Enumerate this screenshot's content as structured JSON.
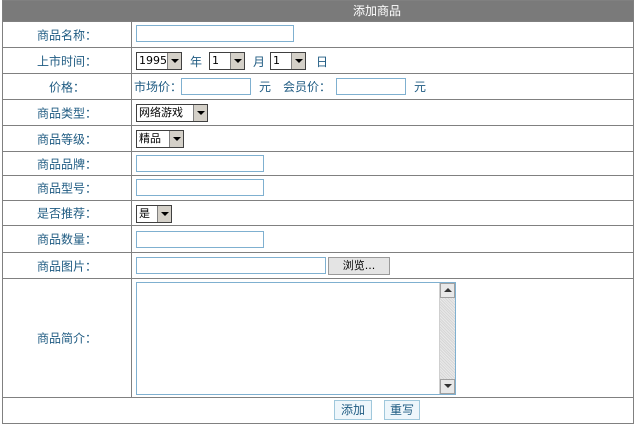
{
  "title": "添加商品",
  "fields": {
    "name": {
      "label": "商品名称：",
      "value": ""
    },
    "release": {
      "label": "上市时间：",
      "year": "1995",
      "year_unit": "年",
      "month": "1",
      "month_unit": "月",
      "day": "1",
      "day_unit": "日"
    },
    "price": {
      "label": "价格：",
      "market_label": "市场价：",
      "member_label": "会员价：",
      "unit": "元"
    },
    "category": {
      "label": "商品类型：",
      "selected": "网络游戏"
    },
    "grade": {
      "label": "商品等级：",
      "selected": "精品"
    },
    "brand": {
      "label": "商品品牌："
    },
    "model": {
      "label": "商品型号："
    },
    "recommend": {
      "label": "是否推荐：",
      "selected": "是"
    },
    "quantity": {
      "label": "商品数量："
    },
    "image": {
      "label": "商品图片：",
      "browse_label": "浏览..."
    },
    "description": {
      "label": "商品简介："
    }
  },
  "actions": {
    "add_label": "添加",
    "reset_label": "重写"
  }
}
